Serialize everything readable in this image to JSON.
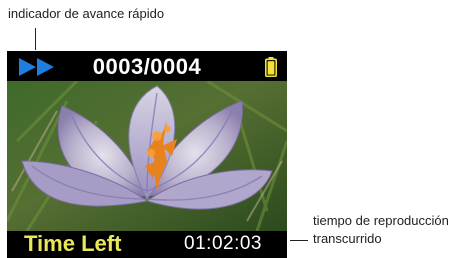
{
  "callouts": {
    "fast_forward": "indicador de avance rápido",
    "elapsed_line1": "tiempo de reproducción",
    "elapsed_line2": "transcurrido"
  },
  "screen": {
    "counter": "0003/0004",
    "time_label": "Time Left",
    "time_value": "01:02:03",
    "icons": {
      "playback": "fast-forward-icon",
      "battery": "battery-icon"
    },
    "colors": {
      "fast_forward": "#1e7fe0",
      "battery": "#f2e23a",
      "time_label": "#e8e85a"
    }
  }
}
